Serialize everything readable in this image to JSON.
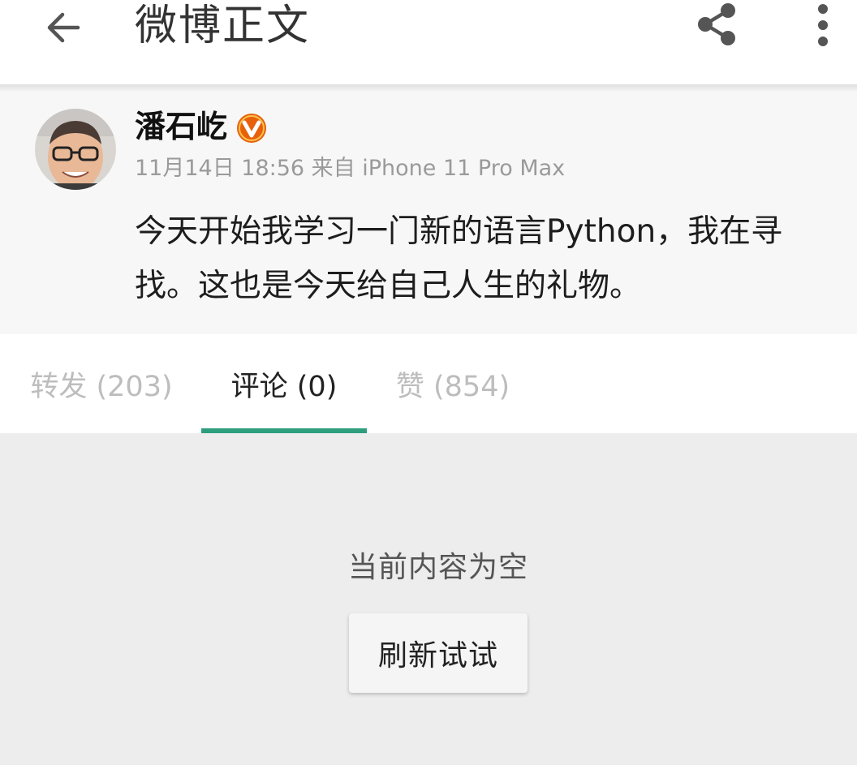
{
  "appbar": {
    "title": "微博正文",
    "back_icon": "arrow-back-icon",
    "share_icon": "share-icon",
    "more_icon": "more-vert-icon"
  },
  "post": {
    "author_name": "潘石屹",
    "verified_icon": "verified-v-icon",
    "verified_color": "#e8600a",
    "meta": "11月14日 18:56 来自 iPhone 11 Pro Max",
    "text": "今天开始我学习一门新的语言Python，我在寻找。这也是今天给自己人生的礼物。"
  },
  "tabs": {
    "repost_label": "转发 (203)",
    "comments_label": "评论 (0)",
    "likes_label": "赞 (854)",
    "active": "comments",
    "accent_color": "#2f9e7d"
  },
  "empty_state": {
    "message": "当前内容为空",
    "refresh_label": "刷新试试"
  }
}
